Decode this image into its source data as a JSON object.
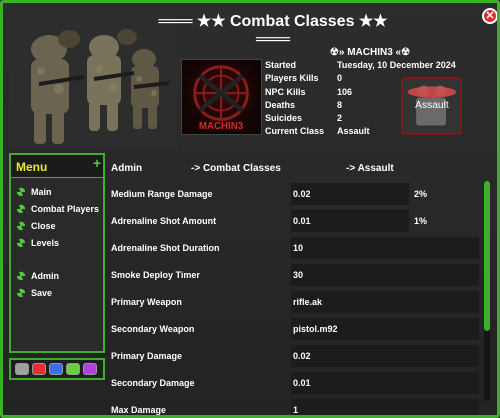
{
  "window": {
    "title": "═══ ★★ Combat Classes ★★ ═══",
    "close_label": "✕"
  },
  "profile": {
    "name": "☢» MACHIN3 «☢",
    "stats": [
      {
        "key": "Started",
        "value": "Tuesday, 10 December 2024"
      },
      {
        "key": "Players Kills",
        "value": "0"
      },
      {
        "key": "NPC Kills",
        "value": "106"
      },
      {
        "key": "Deaths",
        "value": "8"
      },
      {
        "key": "Suicides",
        "value": "2"
      },
      {
        "key": "Current Class",
        "value": "Assault"
      }
    ],
    "avatar_text": "MACHIN3",
    "class_badge_text": "Assault"
  },
  "menu": {
    "title": "Menu",
    "plus": "+",
    "items": [
      {
        "label": "Main"
      },
      {
        "label": "Combat Players"
      },
      {
        "label": "Close"
      },
      {
        "label": "Levels"
      },
      {
        "label": "Admin"
      },
      {
        "label": "Save"
      }
    ]
  },
  "swatches": [
    "#a0a0a0",
    "#e03030",
    "#3a6ee8",
    "#68d040",
    "#b040e0"
  ],
  "breadcrumb": {
    "admin": "Admin",
    "combat": "-> Combat Classes",
    "assault": "-> Assault"
  },
  "rows": [
    {
      "label": "Medium Range Damage",
      "value": "0.02",
      "pct": "2%"
    },
    {
      "label": "Adrenaline Shot Amount",
      "value": "0.01",
      "pct": "1%"
    },
    {
      "label": "Adrenaline Shot Duration",
      "value": "10",
      "pct": ""
    },
    {
      "label": "Smoke Deploy Timer",
      "value": "30",
      "pct": ""
    },
    {
      "label": "Primary Weapon",
      "value": "rifle.ak",
      "pct": ""
    },
    {
      "label": "Secondary Weapon",
      "value": "pistol.m92",
      "pct": ""
    },
    {
      "label": "Primary Damage",
      "value": "0.02",
      "pct": ""
    },
    {
      "label": "Secondary Damage",
      "value": "0.01",
      "pct": ""
    },
    {
      "label": "Max Damage",
      "value": "1",
      "pct": ""
    }
  ],
  "colors": {
    "accent": "#3fae2c",
    "menu_title": "#e8e835"
  }
}
